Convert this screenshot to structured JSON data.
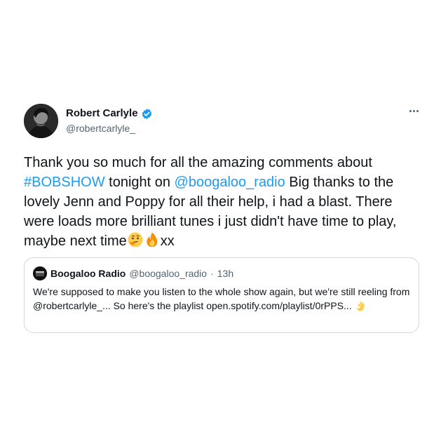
{
  "author": {
    "display_name": "Robert Carlyle",
    "handle": "@robertcarlyle_",
    "verified": true
  },
  "more_icon": "more-horizontal-icon",
  "tweet": {
    "t1": "Thank you so much for all the amazing comments about ",
    "hashtag": "#BOBSHOW",
    "t2": " tonight on ",
    "mention": "@boogaloo_radio",
    "t3": " Big thanks to the lovely Jenn and Poppy for all their help, i had a blast. There were loads more brilliant tunes i just didn't have time to play, maybe next time",
    "emojis": [
      "thinking-face-icon",
      "fire-icon"
    ],
    "t4": "xx"
  },
  "quote": {
    "display_name": "Boogaloo Radio",
    "handle": "@boogaloo_radio",
    "separator": "·",
    "time": "13h",
    "body": "We're supposed to make you listen to the whole show again, but we're still reeling from @robertcarlyle_... So here's the playlist open.spotify.com/playlist/0rPPS...",
    "emoji": "ok-hand-icon"
  },
  "colors": {
    "link": "#1d9bf0",
    "text": "#0f1419",
    "secondary": "#536471",
    "border": "#cfd9de"
  }
}
